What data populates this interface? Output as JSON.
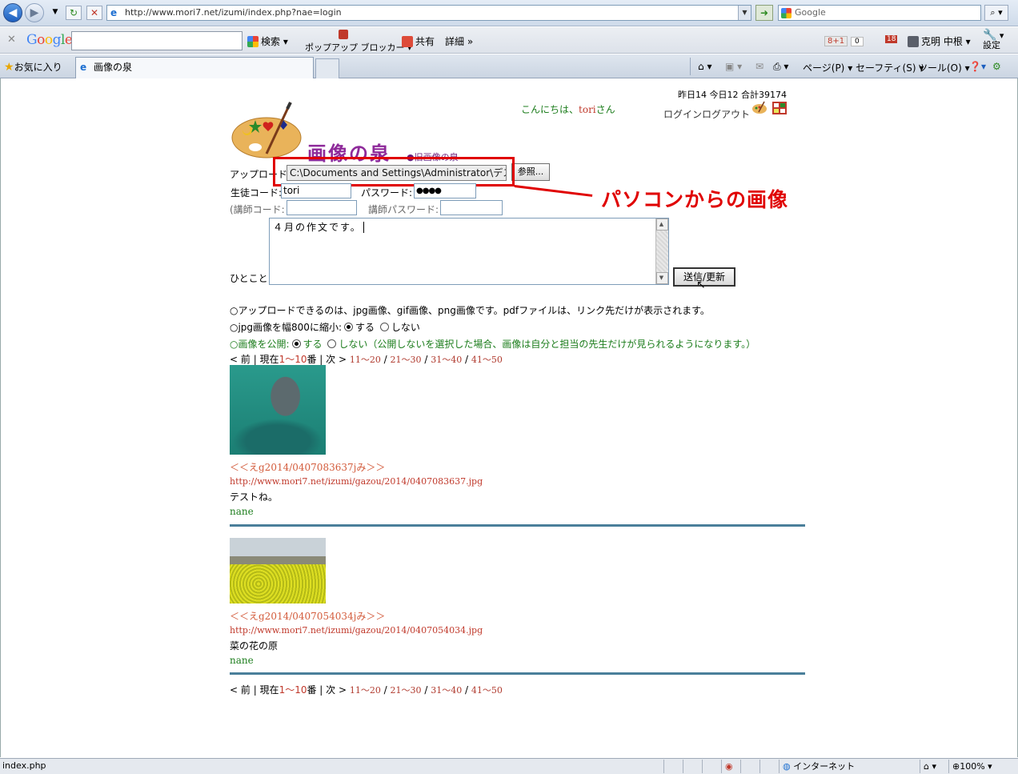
{
  "browser": {
    "url": "http://www.mori7.net/izumi/index.php?nae=login",
    "search_placeholder": "Google",
    "google_toolbar": {
      "search_label": "検索",
      "popup_blocker_label": "ポップアップ ブロッカー",
      "share_label": "共有",
      "details_label": "詳細",
      "plus_count": "0",
      "plus_label": "8+1",
      "notifications": "18",
      "user_name": "克明 中根",
      "settings_label": "設定"
    },
    "favorites_label": "お気に入り",
    "tab_title": "画像の泉",
    "commands": {
      "page": "ページ(P)",
      "safety": "セーフティ(S)",
      "tools": "ツール(O)"
    },
    "status": {
      "left_text": "index.php",
      "zone": "インターネット",
      "zoom": "100%"
    }
  },
  "page": {
    "counter": "昨日14 今日12 合計39174",
    "greeting_prefix": "こんにちは、",
    "greeting_name": "tori",
    "greeting_suffix": "さん",
    "login_label": "ログイン",
    "logout_label": "ログアウト",
    "site_title": "画像の泉",
    "old_link": "●旧画像の泉",
    "form": {
      "upload_label": "アップロード:",
      "file_value": "C:\\Documents and Settings\\Administrator\\デス",
      "browse_label": "参照...",
      "student_code_label": "生徒コード:",
      "student_code_value": "tori",
      "password_label": "パスワード:",
      "password_value": "●●●●",
      "teacher_code_label": "(講師コード:",
      "teacher_password_label": "講師パスワード:",
      "comment_label": "ひとこと:",
      "comment_value": "４月の作文です。",
      "submit_label": "送信/更新"
    },
    "annotation": "パソコンからの画像",
    "notes": {
      "formats": "○アップロードできるのは、jpg画像、gif画像、png画像です。pdfファイルは、リンク先だけが表示されます。",
      "shrink_label": "○jpg画像を幅800に縮小:",
      "shrink_yes": "する",
      "shrink_no": "しない",
      "publish_label": "○画像を公開:",
      "publish_yes": "する",
      "publish_no": "しない（公開しないを選択した場合、画像は自分と担当の先生だけが見られるようになります。）"
    },
    "pager": {
      "prev": "< 前",
      "current_prefix": "現在",
      "current_range": "1〜10",
      "current_suffix": "番",
      "next": "次 >",
      "pages": [
        "11〜20",
        "21〜30",
        "31〜40",
        "41〜50"
      ]
    },
    "posts": [
      {
        "link": "＜＜えg2014/0407083637jみ＞＞",
        "url": "http://www.mori7.net/izumi/gazou/2014/0407083637.jpg",
        "message": "テストね。",
        "user": "nane"
      },
      {
        "link": "＜＜えg2014/0407054034jみ＞＞",
        "url": "http://www.mori7.net/izumi/gazou/2014/0407054034.jpg",
        "message": "菜の花の原",
        "user": "nane"
      }
    ]
  }
}
